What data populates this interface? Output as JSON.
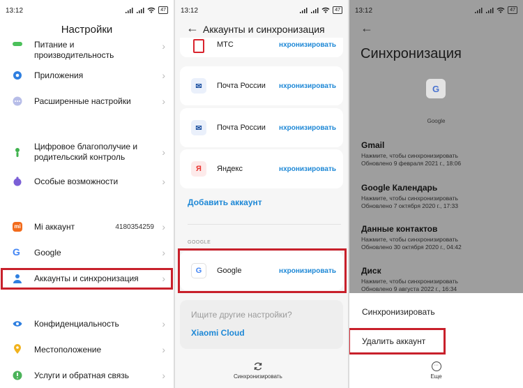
{
  "statusbar": {
    "time": "13:12",
    "battery": "47"
  },
  "settings": {
    "title": "Настройки",
    "items": [
      {
        "label1": "Питание и",
        "label2": "производительность"
      },
      {
        "label": "Приложения"
      },
      {
        "label": "Расширенные настройки"
      },
      {
        "label1": "Цифровое благополучие и",
        "label2": "родительский контроль"
      },
      {
        "label": "Особые возможности"
      },
      {
        "label": "Mi аккаунт",
        "value": "4180354259"
      },
      {
        "label": "Google"
      },
      {
        "label": "Аккаунты и синхронизация"
      },
      {
        "label": "Конфиденциальность"
      },
      {
        "label": "Местоположение"
      },
      {
        "label": "Услуги и обратная связь"
      }
    ]
  },
  "accounts": {
    "title": "Аккаунты и синхронизация",
    "sync_label": "нхронизировать",
    "cards": [
      {
        "name": "МТС"
      },
      {
        "name": "Почта России"
      },
      {
        "name": "Почта России"
      },
      {
        "name": "Яндекс"
      }
    ],
    "add_account": "Добавить аккаунт",
    "google_section": "GOOGLE",
    "google_card": {
      "name": "Google"
    },
    "search_prompt": "Ищите другие настройки?",
    "xiaomi_cloud": "Xiaomi Cloud",
    "bottom_action": "Синхронизировать"
  },
  "sync": {
    "title": "Синхронизация",
    "account_label": "Google",
    "services": [
      {
        "name": "Gmail",
        "line1": "Нажмите, чтобы синхронизировать",
        "line2": "Обновлено 9 февраля 2021 г., 18:06"
      },
      {
        "name": "Google Календарь",
        "line1": "Нажмите, чтобы синхронизировать",
        "line2": "Обновлено 7 октября 2020 г., 17:33"
      },
      {
        "name": "Данные контактов",
        "line1": "Нажмите, чтобы синхронизировать",
        "line2": "Обновлено 30 октября 2020 г., 04:42"
      },
      {
        "name": "Диск",
        "line1": "Нажмите, чтобы синхронизировать",
        "line2": "Обновлено 9 августа 2022 г., 16:34"
      }
    ],
    "menu": {
      "sync": "Синхронизировать",
      "delete": "Удалить аккаунт"
    },
    "more": "Еще"
  },
  "colors": {
    "accent": "#1e88d6",
    "highlight": "#c8202b",
    "dim_overlay": "#9e9e9e"
  }
}
